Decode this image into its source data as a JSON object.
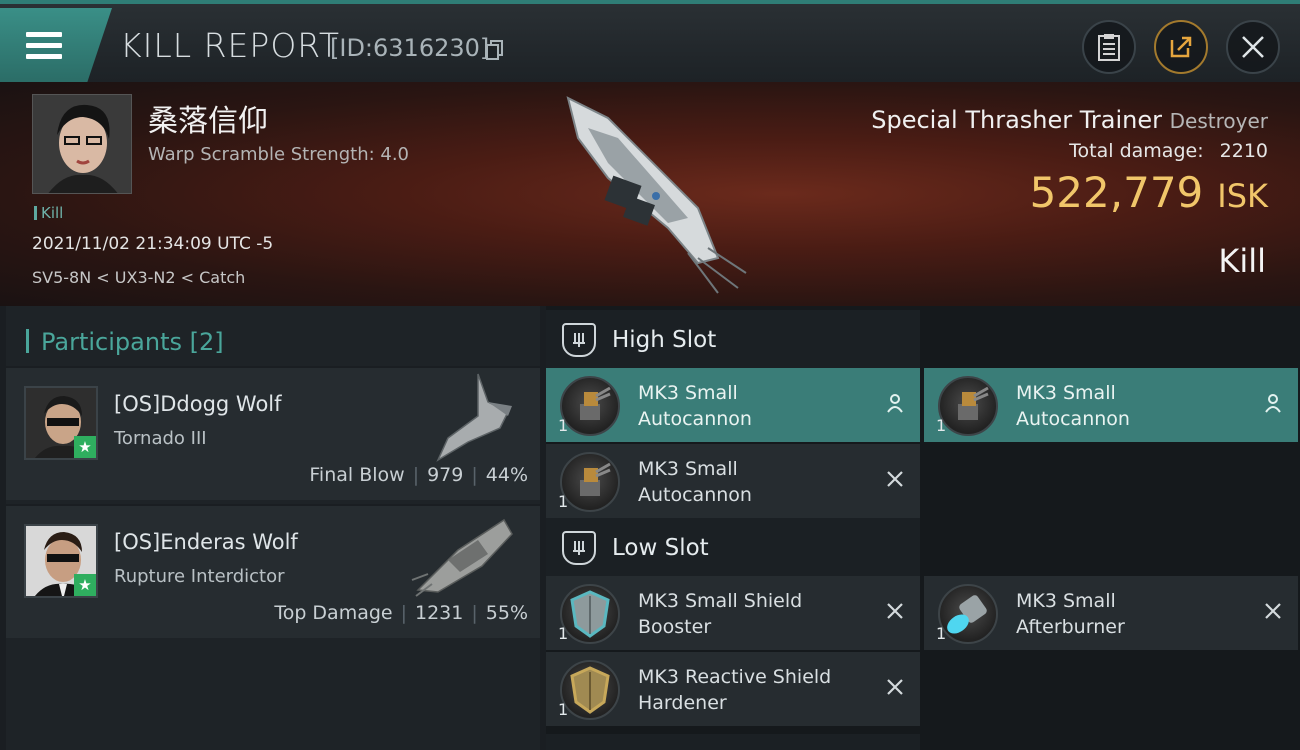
{
  "header": {
    "title": "KILL REPORT",
    "report_id": "[ID:6316230]",
    "icons": [
      "menu-icon",
      "copy-icon",
      "clipboard-icon",
      "share-icon",
      "close-icon"
    ]
  },
  "victim": {
    "name": "桑落信仰",
    "scramble": "Warp Scramble Strength: 4.0",
    "kill_tag": "Kill",
    "datetime": "2021/11/02 21:34:09 UTC -5",
    "location": "SV5-8N < UX3-N2 < Catch",
    "ship_name": "Special Thrasher Trainer",
    "ship_class": "Destroyer",
    "total_damage_label": "Total damage:",
    "total_damage": "2210",
    "isk_value": "522,779",
    "isk_unit": "ISK",
    "kill_type": "Kill"
  },
  "participants": {
    "header": "Participants [2]",
    "items": [
      {
        "name": "[OS]Ddogg Wolf",
        "ship": "Tornado III",
        "role": "Final Blow",
        "damage": "979",
        "percent": "44%"
      },
      {
        "name": "[OS]Enderas Wolf",
        "ship": "Rupture Interdictor",
        "role": "Top Damage",
        "damage": "1231",
        "percent": "55%"
      }
    ]
  },
  "fitting": {
    "high_slot_label": "High Slot",
    "low_slot_label": "Low Slot",
    "high": [
      {
        "line1": "MK3 Small",
        "line2": "Autocannon",
        "qty": "1",
        "status": "person-icon"
      },
      {
        "line1": "MK3 Small",
        "line2": "Autocannon",
        "qty": "1",
        "status": "person-icon"
      },
      {
        "line1": "MK3 Small",
        "line2": "Autocannon",
        "qty": "1",
        "status": "x-icon"
      }
    ],
    "low": [
      {
        "line1": "MK3 Small Shield",
        "line2": "Booster",
        "qty": "1",
        "status": "x-icon"
      },
      {
        "line1": "MK3 Small",
        "line2": "Afterburner",
        "qty": "1",
        "status": "x-icon"
      },
      {
        "line1": "MK3 Reactive Shield",
        "line2": "Hardener",
        "qty": "1",
        "status": "x-icon"
      }
    ]
  },
  "colors": {
    "accent": "#3a7d78",
    "isk": "#f1c66a",
    "hero_red": "#6b2a1c"
  }
}
